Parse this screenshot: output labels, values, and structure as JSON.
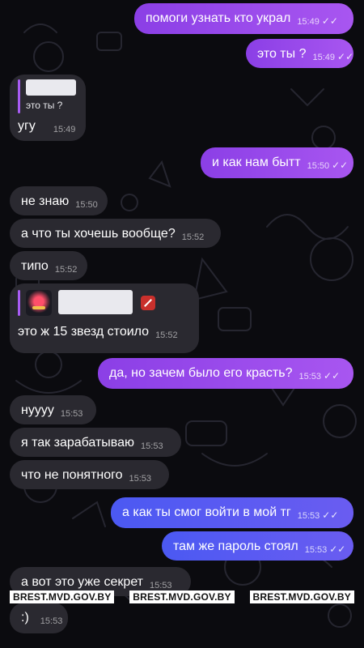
{
  "messages": [
    {
      "dir": "out",
      "text": "помоги узнать кто украл",
      "time": "15:49"
    },
    {
      "dir": "out",
      "text": "это ты ?",
      "time": "15:49"
    },
    {
      "dir": "in",
      "text": "угу",
      "time": "15:49",
      "reply_quote": "это ты ?"
    },
    {
      "dir": "out",
      "text": "и как нам бытт",
      "time": "15:50"
    },
    {
      "dir": "in",
      "text": "не знаю",
      "time": "15:50"
    },
    {
      "dir": "in",
      "text": "а что ты хочешь вообще?",
      "time": "15:52"
    },
    {
      "dir": "in",
      "text": "типо",
      "time": "15:52"
    },
    {
      "dir": "in",
      "text": "это ж 15 звезд стоило",
      "time": "15:52"
    },
    {
      "dir": "out",
      "text": "да, но зачем было его красть?",
      "time": "15:53"
    },
    {
      "dir": "in",
      "text": "нуууу",
      "time": "15:53"
    },
    {
      "dir": "in",
      "text": "я так зарабатываю",
      "time": "15:53"
    },
    {
      "dir": "in",
      "text": "что не понятного",
      "time": "15:53"
    },
    {
      "dir": "out",
      "text": "а как ты смог войти в мой тг",
      "time": "15:53"
    },
    {
      "dir": "out",
      "text": "там же пароль стоял",
      "time": "15:53"
    },
    {
      "dir": "in",
      "text": "а вот это уже секрет",
      "time": "15:53"
    },
    {
      "dir": "in",
      "text": ":)",
      "time": "15:53"
    }
  ],
  "watermark": {
    "left": "BREST.MVD.GOV.BY",
    "center": "BREST.MVD.GOV.BY",
    "right": "BREST.MVD.GOV.BY"
  },
  "colors": {
    "bg": "#0b0b0f",
    "outgoing": "#9a4cf0",
    "outgoing_blue": "#5a5bf2",
    "incoming": "#2a2930"
  },
  "icons": {
    "read_receipt": "double-check-icon",
    "reply_sticker": "sticker-thumbnail",
    "game": "dota-icon"
  }
}
